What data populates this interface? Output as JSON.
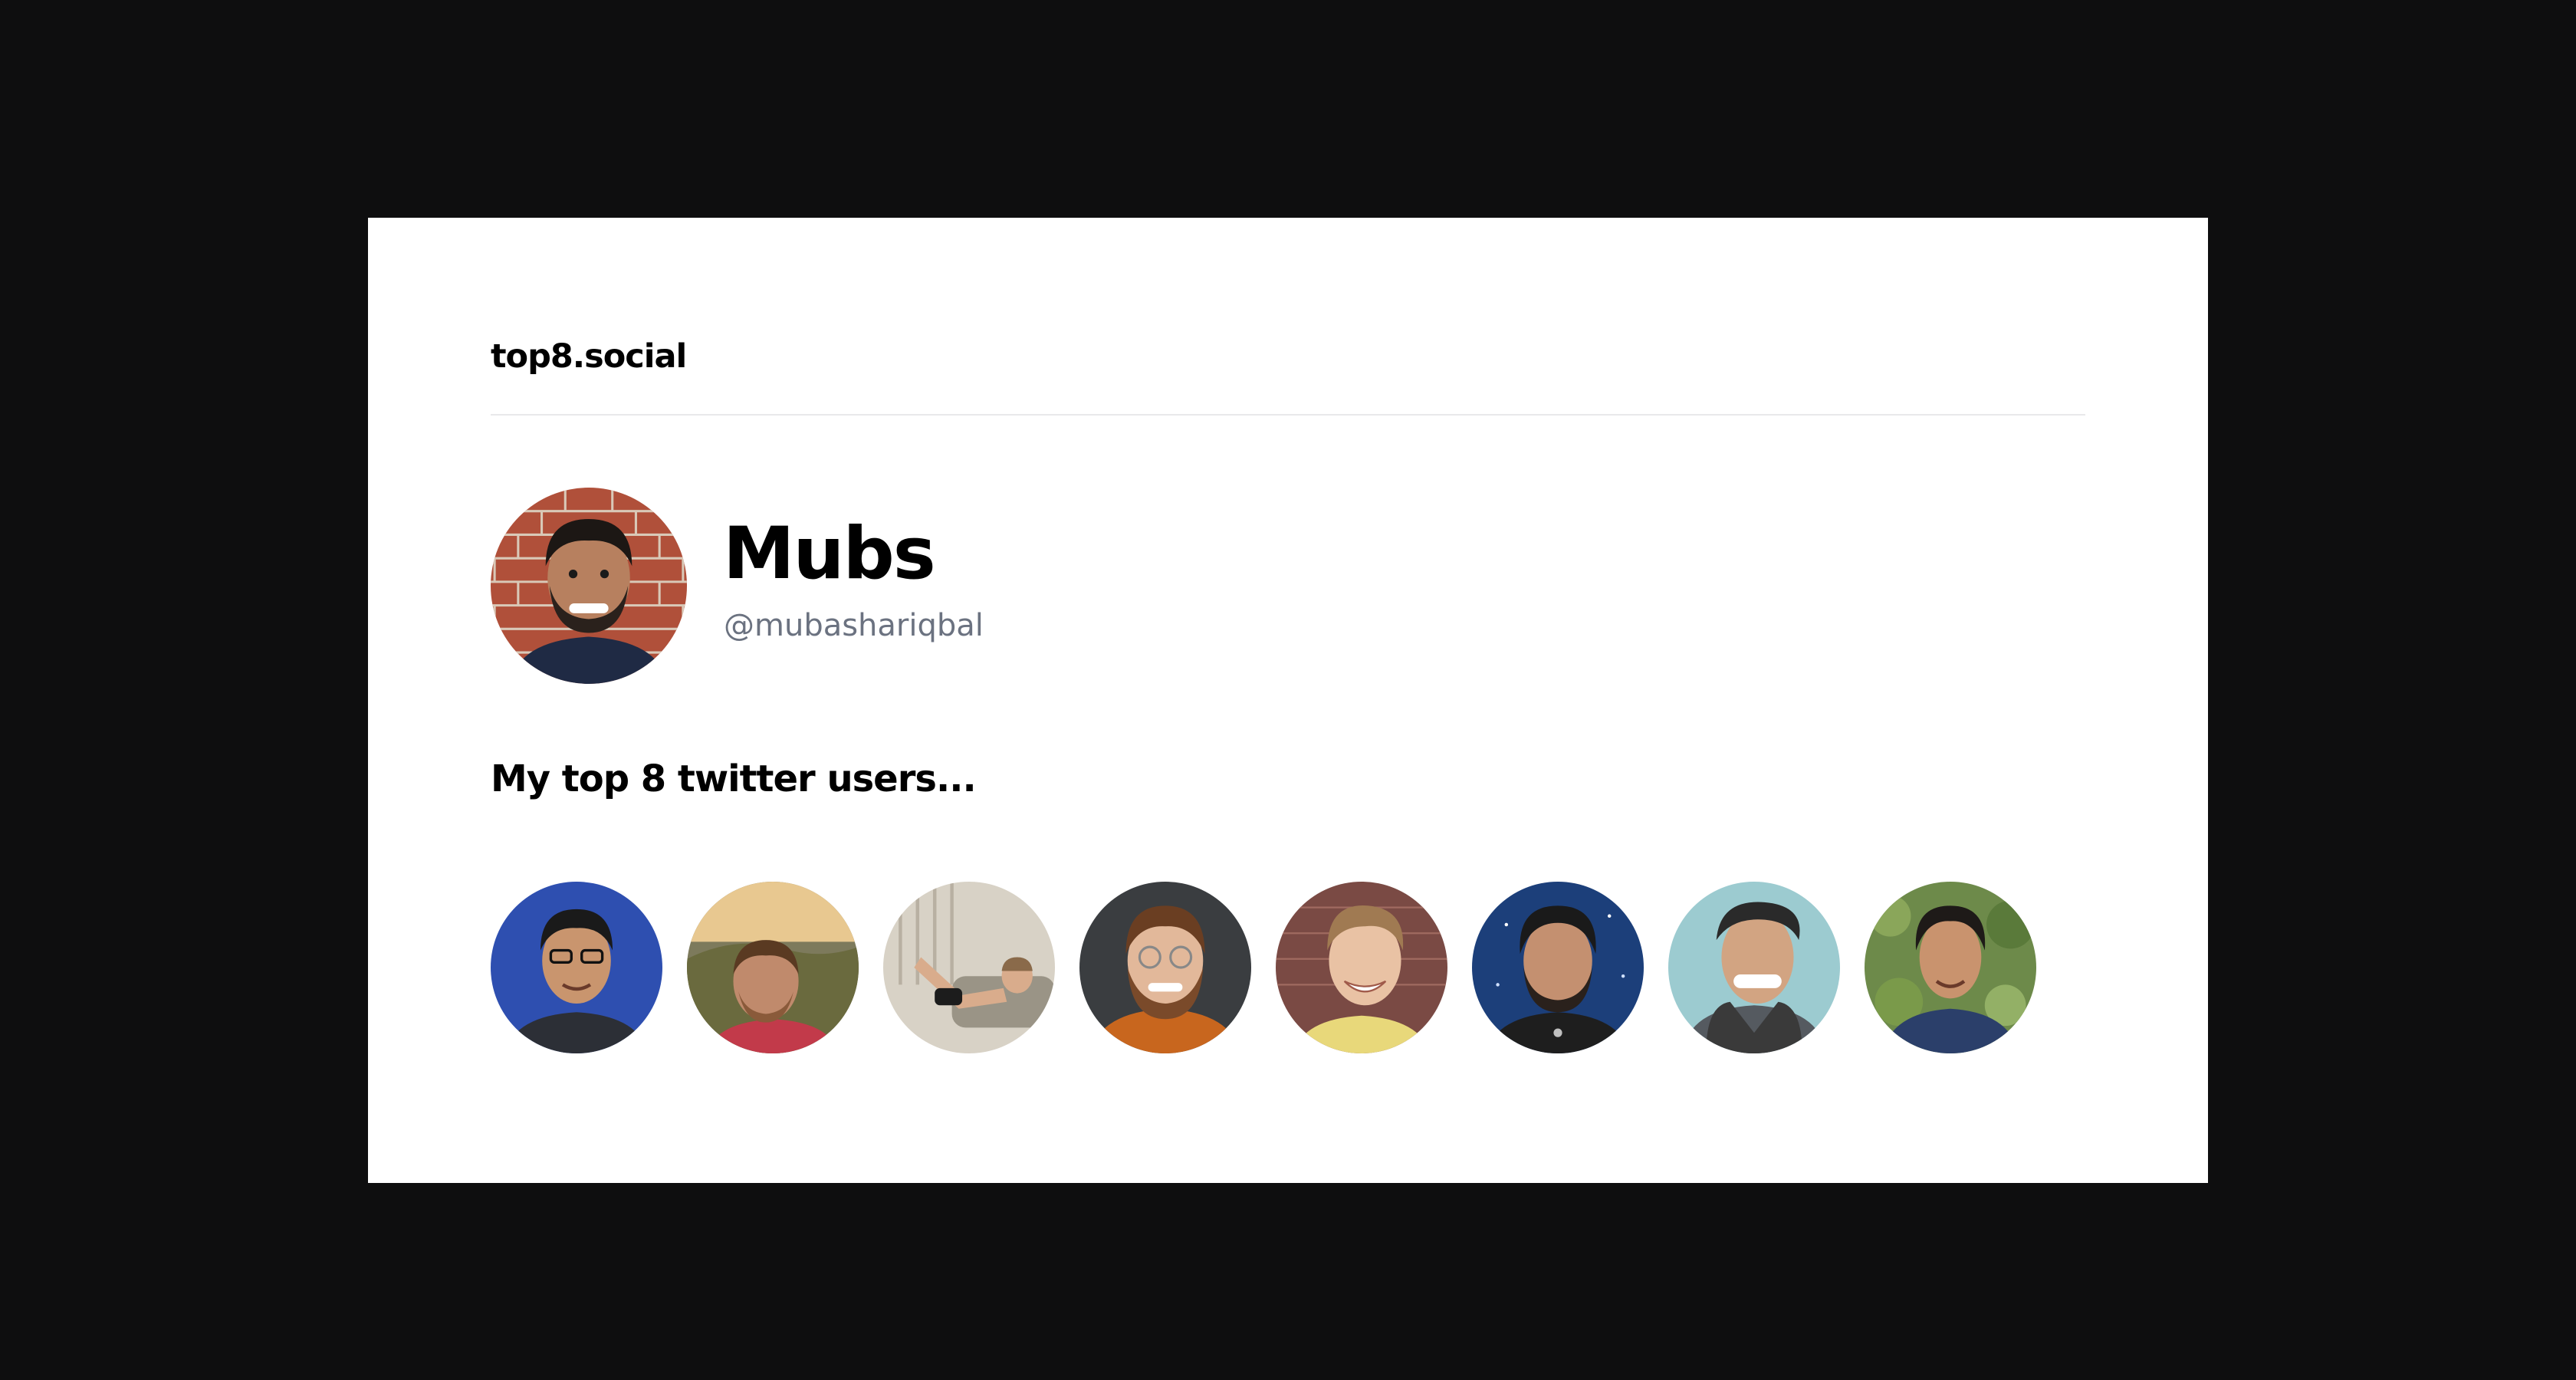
{
  "site": {
    "brand": "top8.social"
  },
  "profile": {
    "display_name": "Mubs",
    "handle": "@mubashariqbal",
    "avatar_icon": "profile-photo"
  },
  "top8": {
    "heading": "My top 8 twitter users...",
    "friends": [
      {
        "avatar_icon": "friend-photo",
        "bg": "#2e4fb0",
        "skin": "#c9956e",
        "hair": "#1a1a1a",
        "shirt": "#2c2f36"
      },
      {
        "avatar_icon": "friend-photo",
        "bg": "#7d7a5c",
        "skin": "#c08a6c",
        "hair": "#5a3a22",
        "shirt": "#c23a4a"
      },
      {
        "avatar_icon": "friend-photo",
        "bg": "#d8d2c6",
        "skin": "#d9ac8c",
        "hair": "#8a6a4a",
        "shirt": "#1c1c1c"
      },
      {
        "avatar_icon": "friend-photo",
        "bg": "#3a3d40",
        "skin": "#e2b89a",
        "hair": "#6a3e22",
        "shirt": "#c8661e"
      },
      {
        "avatar_icon": "friend-photo",
        "bg": "#7a4a44",
        "skin": "#e9c2a4",
        "hair": "#a07a52",
        "shirt": "#e8d87a"
      },
      {
        "avatar_icon": "friend-photo",
        "bg": "#1c3f7a",
        "skin": "#c49070",
        "hair": "#1a1a1a",
        "shirt": "#1e1e1e"
      },
      {
        "avatar_icon": "friend-photo",
        "bg": "#9ccbd0",
        "skin": "#d2a482",
        "hair": "#2a2a2a",
        "shirt": "#555a60"
      },
      {
        "avatar_icon": "friend-photo",
        "bg": "#6d8a4a",
        "skin": "#c9936e",
        "hair": "#1e1a18",
        "shirt": "#2b3f6a"
      }
    ]
  }
}
